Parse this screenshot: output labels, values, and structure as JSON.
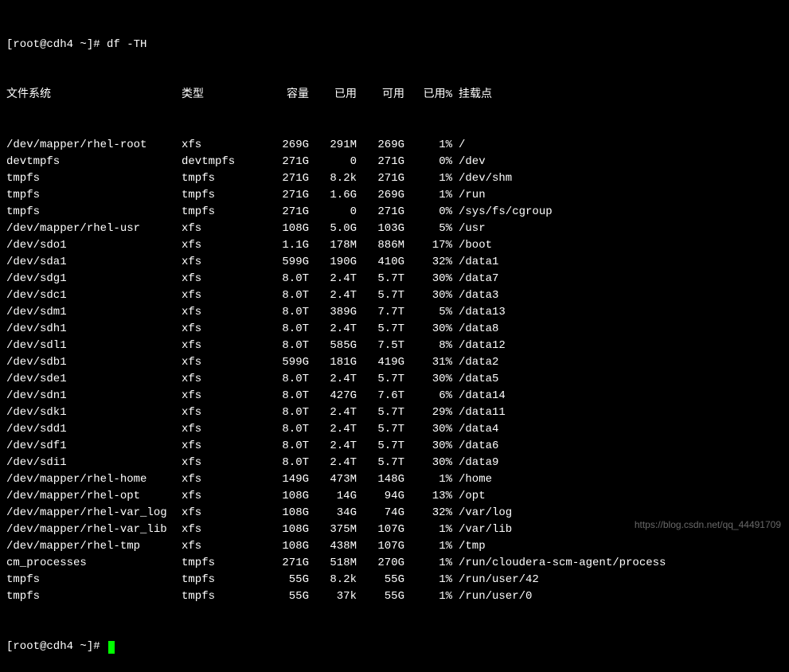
{
  "prompt1": "[root@cdh4 ~]# ",
  "command": "df -TH",
  "prompt2": "[root@cdh4 ~]# ",
  "headers": {
    "filesystem": "文件系统",
    "type": "类型",
    "size": "容量",
    "used": "已用",
    "avail": "可用",
    "usepct": "已用%",
    "mount": "挂载点"
  },
  "rows": [
    {
      "fs": "/dev/mapper/rhel-root",
      "type": "xfs",
      "size": "269G",
      "used": "291M",
      "avail": "269G",
      "pct": "1%",
      "mount": "/"
    },
    {
      "fs": "devtmpfs",
      "type": "devtmpfs",
      "size": "271G",
      "used": "0",
      "avail": "271G",
      "pct": "0%",
      "mount": "/dev"
    },
    {
      "fs": "tmpfs",
      "type": "tmpfs",
      "size": "271G",
      "used": "8.2k",
      "avail": "271G",
      "pct": "1%",
      "mount": "/dev/shm"
    },
    {
      "fs": "tmpfs",
      "type": "tmpfs",
      "size": "271G",
      "used": "1.6G",
      "avail": "269G",
      "pct": "1%",
      "mount": "/run"
    },
    {
      "fs": "tmpfs",
      "type": "tmpfs",
      "size": "271G",
      "used": "0",
      "avail": "271G",
      "pct": "0%",
      "mount": "/sys/fs/cgroup"
    },
    {
      "fs": "/dev/mapper/rhel-usr",
      "type": "xfs",
      "size": "108G",
      "used": "5.0G",
      "avail": "103G",
      "pct": "5%",
      "mount": "/usr"
    },
    {
      "fs": "/dev/sdo1",
      "type": "xfs",
      "size": "1.1G",
      "used": "178M",
      "avail": "886M",
      "pct": "17%",
      "mount": "/boot"
    },
    {
      "fs": "/dev/sda1",
      "type": "xfs",
      "size": "599G",
      "used": "190G",
      "avail": "410G",
      "pct": "32%",
      "mount": "/data1"
    },
    {
      "fs": "/dev/sdg1",
      "type": "xfs",
      "size": "8.0T",
      "used": "2.4T",
      "avail": "5.7T",
      "pct": "30%",
      "mount": "/data7"
    },
    {
      "fs": "/dev/sdc1",
      "type": "xfs",
      "size": "8.0T",
      "used": "2.4T",
      "avail": "5.7T",
      "pct": "30%",
      "mount": "/data3"
    },
    {
      "fs": "/dev/sdm1",
      "type": "xfs",
      "size": "8.0T",
      "used": "389G",
      "avail": "7.7T",
      "pct": "5%",
      "mount": "/data13"
    },
    {
      "fs": "/dev/sdh1",
      "type": "xfs",
      "size": "8.0T",
      "used": "2.4T",
      "avail": "5.7T",
      "pct": "30%",
      "mount": "/data8"
    },
    {
      "fs": "/dev/sdl1",
      "type": "xfs",
      "size": "8.0T",
      "used": "585G",
      "avail": "7.5T",
      "pct": "8%",
      "mount": "/data12"
    },
    {
      "fs": "/dev/sdb1",
      "type": "xfs",
      "size": "599G",
      "used": "181G",
      "avail": "419G",
      "pct": "31%",
      "mount": "/data2"
    },
    {
      "fs": "/dev/sde1",
      "type": "xfs",
      "size": "8.0T",
      "used": "2.4T",
      "avail": "5.7T",
      "pct": "30%",
      "mount": "/data5"
    },
    {
      "fs": "/dev/sdn1",
      "type": "xfs",
      "size": "8.0T",
      "used": "427G",
      "avail": "7.6T",
      "pct": "6%",
      "mount": "/data14"
    },
    {
      "fs": "/dev/sdk1",
      "type": "xfs",
      "size": "8.0T",
      "used": "2.4T",
      "avail": "5.7T",
      "pct": "29%",
      "mount": "/data11"
    },
    {
      "fs": "/dev/sdd1",
      "type": "xfs",
      "size": "8.0T",
      "used": "2.4T",
      "avail": "5.7T",
      "pct": "30%",
      "mount": "/data4"
    },
    {
      "fs": "/dev/sdf1",
      "type": "xfs",
      "size": "8.0T",
      "used": "2.4T",
      "avail": "5.7T",
      "pct": "30%",
      "mount": "/data6"
    },
    {
      "fs": "/dev/sdi1",
      "type": "xfs",
      "size": "8.0T",
      "used": "2.4T",
      "avail": "5.7T",
      "pct": "30%",
      "mount": "/data9"
    },
    {
      "fs": "/dev/mapper/rhel-home",
      "type": "xfs",
      "size": "149G",
      "used": "473M",
      "avail": "148G",
      "pct": "1%",
      "mount": "/home"
    },
    {
      "fs": "/dev/mapper/rhel-opt",
      "type": "xfs",
      "size": "108G",
      "used": "14G",
      "avail": "94G",
      "pct": "13%",
      "mount": "/opt"
    },
    {
      "fs": "/dev/mapper/rhel-var_log",
      "type": "xfs",
      "size": "108G",
      "used": "34G",
      "avail": "74G",
      "pct": "32%",
      "mount": "/var/log"
    },
    {
      "fs": "/dev/mapper/rhel-var_lib",
      "type": "xfs",
      "size": "108G",
      "used": "375M",
      "avail": "107G",
      "pct": "1%",
      "mount": "/var/lib"
    },
    {
      "fs": "/dev/mapper/rhel-tmp",
      "type": "xfs",
      "size": "108G",
      "used": "438M",
      "avail": "107G",
      "pct": "1%",
      "mount": "/tmp"
    },
    {
      "fs": "cm_processes",
      "type": "tmpfs",
      "size": "271G",
      "used": "518M",
      "avail": "270G",
      "pct": "1%",
      "mount": "/run/cloudera-scm-agent/process"
    },
    {
      "fs": "tmpfs",
      "type": "tmpfs",
      "size": "55G",
      "used": "8.2k",
      "avail": "55G",
      "pct": "1%",
      "mount": "/run/user/42"
    },
    {
      "fs": "tmpfs",
      "type": "tmpfs",
      "size": "55G",
      "used": "37k",
      "avail": "55G",
      "pct": "1%",
      "mount": "/run/user/0"
    }
  ],
  "watermark": "https://blog.csdn.net/qq_44491709"
}
